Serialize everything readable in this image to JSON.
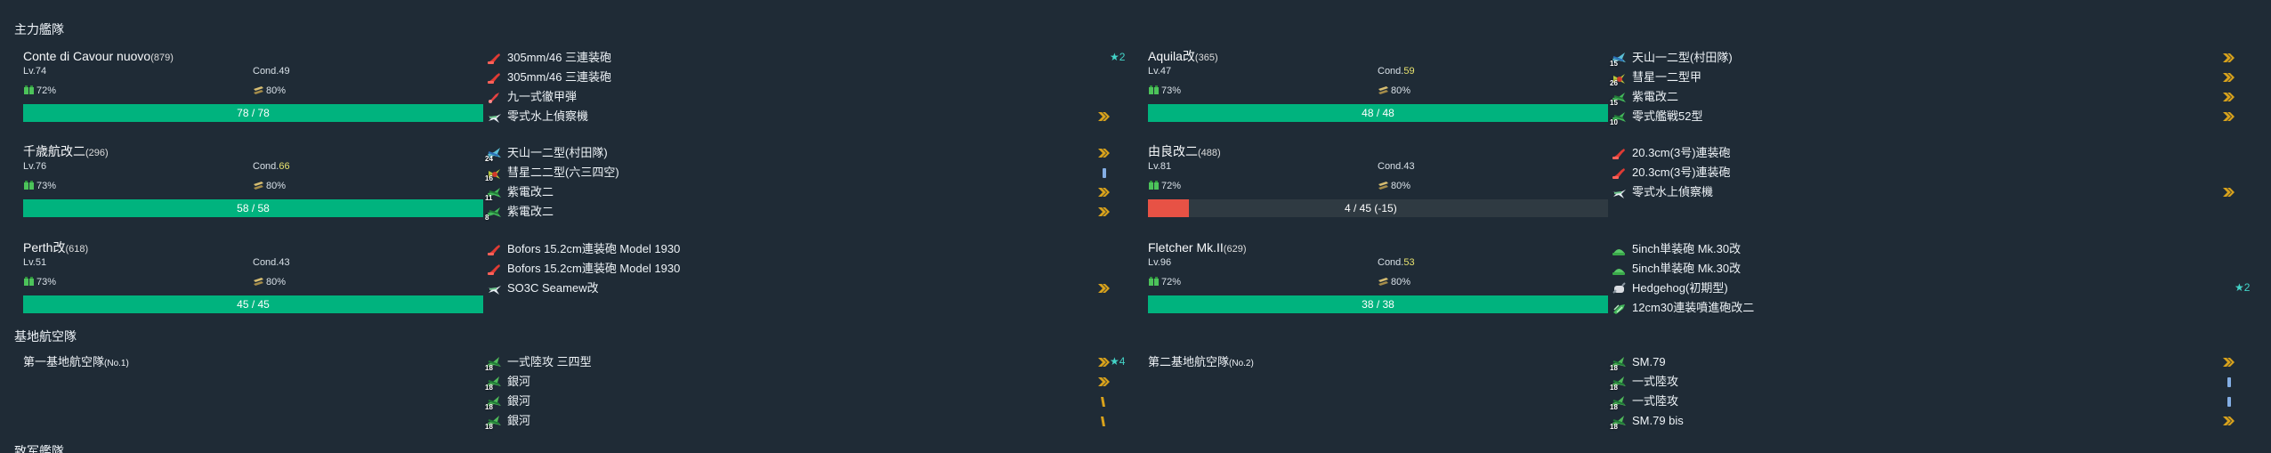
{
  "sections": {
    "main_fleet": "主力艦隊",
    "land_base": "基地航空隊",
    "escort_fleet": "致军艦隊"
  },
  "ships": [
    {
      "name": "Conte di Cavour nuovo",
      "id": "(879)",
      "lv": "Lv.74",
      "cond_label": "Cond.",
      "cond": "49",
      "fuel": "72%",
      "ammo": "80%",
      "hp": "78 / 78",
      "hp_ratio": 1.0,
      "equipment": [
        {
          "name": "305mm/46 三連装砲",
          "icon": "red-main-gun-icon",
          "count": "",
          "proficiency": "",
          "improve": "★2"
        },
        {
          "name": "305mm/46 三連装砲",
          "icon": "red-main-gun-icon",
          "count": "",
          "proficiency": "",
          "improve": ""
        },
        {
          "name": "九一式徹甲弾",
          "icon": "armor-piercing-shell-icon",
          "count": "",
          "proficiency": "",
          "improve": ""
        },
        {
          "name": "零式水上偵察機",
          "icon": "seaplane-icon",
          "count": "",
          "proficiency": "max",
          "improve": ""
        }
      ]
    },
    {
      "name": "千歳航改二",
      "id": "(296)",
      "lv": "Lv.76",
      "cond_label": "Cond.",
      "cond": "66",
      "fuel": "73%",
      "ammo": "80%",
      "hp": "58 / 58",
      "hp_ratio": 1.0,
      "equipment": [
        {
          "name": "天山一二型(村田隊)",
          "icon": "torpedo-bomber-icon",
          "count": "24",
          "proficiency": "max",
          "improve": ""
        },
        {
          "name": "彗星二二型(六三四空)",
          "icon": "dive-bomber-icon",
          "count": "16",
          "proficiency": "low",
          "improve": ""
        },
        {
          "name": "紫電改二",
          "icon": "fighter-icon",
          "count": "11",
          "proficiency": "max",
          "improve": ""
        },
        {
          "name": "紫電改二",
          "icon": "fighter-icon",
          "count": "8",
          "proficiency": "max",
          "improve": ""
        }
      ]
    },
    {
      "name": "Perth改",
      "id": "(618)",
      "lv": "Lv.51",
      "cond_label": "Cond.",
      "cond": "43",
      "fuel": "73%",
      "ammo": "80%",
      "hp": "45 / 45",
      "hp_ratio": 1.0,
      "equipment": [
        {
          "name": "Bofors 15.2cm連装砲 Model 1930",
          "icon": "red-main-gun-icon",
          "count": "",
          "proficiency": "",
          "improve": ""
        },
        {
          "name": "Bofors 15.2cm連装砲 Model 1930",
          "icon": "red-main-gun-icon",
          "count": "",
          "proficiency": "",
          "improve": ""
        },
        {
          "name": "SO3C Seamew改",
          "icon": "seaplane-icon",
          "count": "",
          "proficiency": "max",
          "improve": ""
        }
      ]
    },
    {
      "name": "Aquila改",
      "id": "(365)",
      "lv": "Lv.47",
      "cond_label": "Cond.",
      "cond": "59",
      "fuel": "73%",
      "ammo": "80%",
      "hp": "48 / 48",
      "hp_ratio": 1.0,
      "equipment": [
        {
          "name": "天山一二型(村田隊)",
          "icon": "torpedo-bomber-icon",
          "count": "15",
          "proficiency": "max",
          "improve": ""
        },
        {
          "name": "彗星一二型甲",
          "icon": "dive-bomber-icon",
          "count": "26",
          "proficiency": "max",
          "improve": ""
        },
        {
          "name": "紫電改二",
          "icon": "fighter-icon",
          "count": "15",
          "proficiency": "max",
          "improve": ""
        },
        {
          "name": "零式艦戦52型",
          "icon": "fighter-icon",
          "count": "10",
          "proficiency": "max",
          "improve": ""
        }
      ]
    },
    {
      "name": "由良改二",
      "id": "(488)",
      "lv": "Lv.81",
      "cond_label": "Cond.",
      "cond": "43",
      "fuel": "72%",
      "ammo": "80%",
      "hp": "4 / 45 (-15)",
      "hp_ratio": 0.089,
      "equipment": [
        {
          "name": "20.3cm(3号)連装砲",
          "icon": "red-main-gun-icon",
          "count": "",
          "proficiency": "",
          "improve": ""
        },
        {
          "name": "20.3cm(3号)連装砲",
          "icon": "red-main-gun-icon",
          "count": "",
          "proficiency": "",
          "improve": ""
        },
        {
          "name": "零式水上偵察機",
          "icon": "seaplane-icon",
          "count": "",
          "proficiency": "max",
          "improve": ""
        }
      ]
    },
    {
      "name": "Fletcher Mk.II",
      "id": "(629)",
      "lv": "Lv.96",
      "cond_label": "Cond.",
      "cond": "53",
      "fuel": "72%",
      "ammo": "80%",
      "hp": "38 / 38",
      "hp_ratio": 1.0,
      "equipment": [
        {
          "name": "5inch単装砲 Mk.30改",
          "icon": "green-secondary-gun-icon",
          "count": "",
          "proficiency": "",
          "improve": ""
        },
        {
          "name": "5inch単装砲 Mk.30改",
          "icon": "green-secondary-gun-icon",
          "count": "",
          "proficiency": "",
          "improve": ""
        },
        {
          "name": "Hedgehog(初期型)",
          "icon": "depth-charge-icon",
          "count": "",
          "proficiency": "",
          "improve": "★2"
        },
        {
          "name": "12cm30連装噴進砲改二",
          "icon": "rocket-launcher-icon",
          "count": "",
          "proficiency": "",
          "improve": ""
        }
      ]
    }
  ],
  "air_bases": [
    {
      "name": "第一基地航空隊",
      "id": "(No.1)",
      "equipment": [
        {
          "name": "一式陸攻 三四型",
          "icon": "land-attacker-icon",
          "count": "18",
          "proficiency": "max",
          "improve": "★4"
        },
        {
          "name": "銀河",
          "icon": "land-attacker-icon",
          "count": "18",
          "proficiency": "max",
          "improve": ""
        },
        {
          "name": "銀河",
          "icon": "land-attacker-icon",
          "count": "18",
          "proficiency": "mid",
          "improve": ""
        },
        {
          "name": "銀河",
          "icon": "land-attacker-icon",
          "count": "18",
          "proficiency": "mid",
          "improve": ""
        }
      ]
    },
    {
      "name": "第二基地航空隊",
      "id": "(No.2)",
      "equipment": [
        {
          "name": "SM.79",
          "icon": "land-attacker-icon",
          "count": "18",
          "proficiency": "max",
          "improve": ""
        },
        {
          "name": "一式陸攻",
          "icon": "land-attacker-icon",
          "count": "18",
          "proficiency": "low",
          "improve": ""
        },
        {
          "name": "一式陸攻",
          "icon": "land-attacker-icon",
          "count": "18",
          "proficiency": "low",
          "improve": ""
        },
        {
          "name": "SM.79 bis",
          "icon": "land-attacker-icon",
          "count": "18",
          "proficiency": "max",
          "improve": ""
        }
      ]
    }
  ],
  "colors": {
    "background": "#1f2b36",
    "hp_green": "#00b37e",
    "hp_red": "#e75245",
    "condition_yellow": "#e8e26e",
    "improvement_cyan": "#43d4c8",
    "proficiency_gold": "#d8a21c"
  }
}
